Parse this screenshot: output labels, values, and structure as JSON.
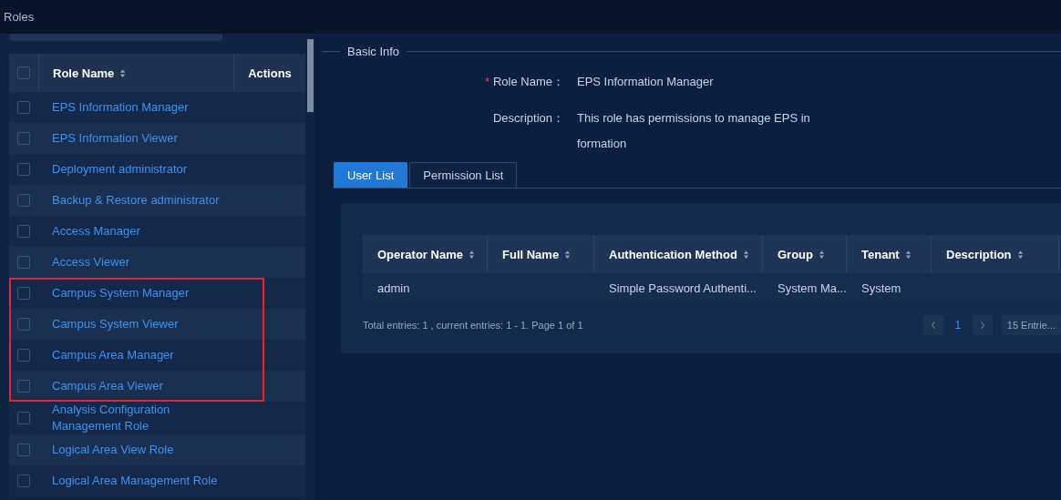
{
  "page_title": "Roles",
  "role_table": {
    "columns": [
      {
        "label": "Role Name",
        "sortable": true
      },
      {
        "label": "Actions",
        "sortable": false
      }
    ],
    "header_checked": false,
    "rows": [
      {
        "name": "EPS Information Manager",
        "checked": false,
        "highlighted": false
      },
      {
        "name": "EPS Information Viewer",
        "checked": false,
        "highlighted": false
      },
      {
        "name": "Deployment administrator",
        "checked": false,
        "highlighted": false
      },
      {
        "name": "Backup & Restore administrator",
        "checked": false,
        "highlighted": false
      },
      {
        "name": "Access Manager",
        "checked": false,
        "highlighted": false
      },
      {
        "name": "Access Viewer",
        "checked": false,
        "highlighted": false
      },
      {
        "name": "Campus System Manager",
        "checked": false,
        "highlighted": true
      },
      {
        "name": "Campus System Viewer",
        "checked": false,
        "highlighted": true
      },
      {
        "name": "Campus Area Manager",
        "checked": false,
        "highlighted": true
      },
      {
        "name": "Campus Area Viewer",
        "checked": false,
        "highlighted": true
      },
      {
        "name": "Analysis Configuration Management Role",
        "checked": false,
        "highlighted": false
      },
      {
        "name": "Logical Area View Role",
        "checked": false,
        "highlighted": false
      },
      {
        "name": "Logical Area Management Role",
        "checked": false,
        "highlighted": false
      }
    ]
  },
  "basic_info": {
    "title": "Basic Info",
    "fields": [
      {
        "label": "Role Name：",
        "required_marker": "*",
        "value": "EPS Information Manager"
      },
      {
        "label": "Description：",
        "value": "This role has permissions to manage EPS in formation"
      }
    ]
  },
  "tabs": [
    {
      "label": "User List",
      "selected": true
    },
    {
      "label": "Permission List",
      "selected": false
    }
  ],
  "user_table": {
    "columns": [
      {
        "label": "Operator Name",
        "sortable": true
      },
      {
        "label": "Full Name",
        "sortable": true
      },
      {
        "label": "Authentication Method",
        "sortable": true
      },
      {
        "label": "Group",
        "sortable": true
      },
      {
        "label": "Tenant",
        "sortable": true
      },
      {
        "label": "Description",
        "sortable": true
      }
    ],
    "rows": [
      [
        "admin",
        "",
        "Simple Password Authenti...",
        "System Ma...",
        "System",
        ""
      ]
    ]
  },
  "pagination": {
    "summary": "Total entries: 1 , current entries: 1 - 1. Page 1 of 1",
    "pages": [
      {
        "label": "1",
        "selected": true
      }
    ],
    "page_size": "15 Entrie..."
  }
}
